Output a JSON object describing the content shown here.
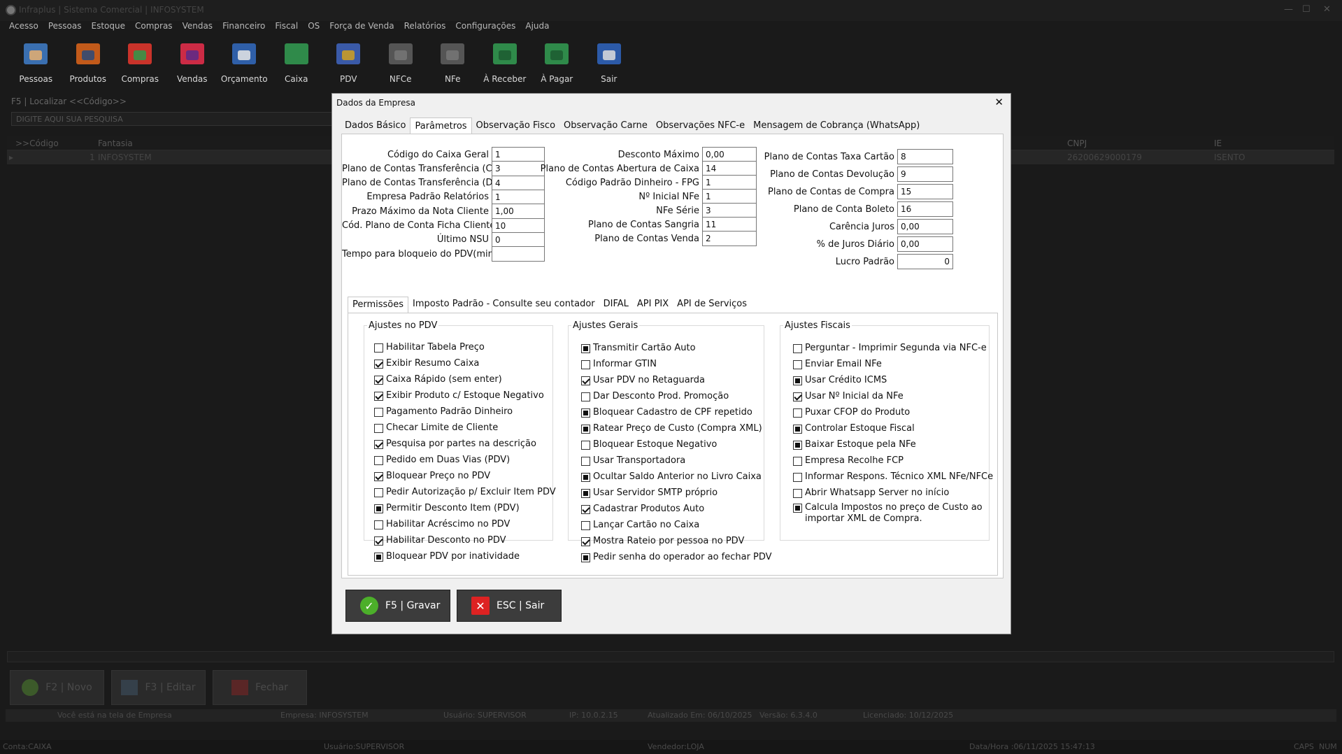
{
  "window": {
    "title": "Infraplus | Sistema Comercial | INFOSYSTEM"
  },
  "menu": [
    "Acesso",
    "Pessoas",
    "Estoque",
    "Compras",
    "Vendas",
    "Financeiro",
    "Fiscal",
    "OS",
    "Força de Venda",
    "Relatórios",
    "Configurações",
    "Ajuda"
  ],
  "toolbar": [
    "Pessoas",
    "Produtos",
    "Compras",
    "Vendas",
    "Orçamento",
    "Caixa",
    "PDV",
    "NFCe",
    "NFe",
    "À Receber",
    "À Pagar",
    "Sair"
  ],
  "background": {
    "search_label": "F5 | Localizar <<Código>>",
    "search_placeholder": "DIGITE AQUI SUA PESQUISA",
    "col_code": ">>Código",
    "col_fantasia": "Fantasia",
    "col_cnpj": "CNPJ",
    "col_ie": "IE",
    "row_code": "1",
    "row_fantasia": "INFOSYSTEM",
    "row_cnpj": "26200629000179",
    "row_ie": "ISENTO",
    "btn_new": "F2 | Novo",
    "btn_edit": "F3 | Editar",
    "btn_close": "Fechar",
    "status_screen": "Você está na tela de Empresa",
    "status_company": "Empresa: INFOSYSTEM",
    "status_user": "Usuário: SUPERVISOR",
    "status_ip": "IP: 10.0.2.15",
    "status_updated": "Atualizado Em: 06/10/2025",
    "status_version": "Versão: 6.3.4.0",
    "status_license": "Licenciado: 10/12/2025",
    "bottom_conta": "Conta:CAIXA",
    "bottom_user": "Usuário:SUPERVISOR",
    "bottom_seller": "Vendedor:LOJA",
    "bottom_datetime": "Data/Hora :06/11/2025 15:47:13",
    "bottom_caps": "CAPS",
    "bottom_num": "NUM"
  },
  "dialog": {
    "title": "Dados da Empresa",
    "tabs": [
      "Dados Básico",
      "Parâmetros",
      "Observação Fisco",
      "Observação Carne",
      "Observações NFC-e",
      "Mensagem de Cobrança (WhatsApp)"
    ],
    "params_col1": [
      {
        "label": "Código do Caixa Geral",
        "value": "1"
      },
      {
        "label": "Plano de Contas Transferência (Crédito)",
        "value": "3"
      },
      {
        "label": "Plano de Contas Transferência (Débito)",
        "value": "4"
      },
      {
        "label": "Empresa Padrão Relatórios",
        "value": "1"
      },
      {
        "label": "Prazo Máximo da Nota Cliente",
        "value": "1,00"
      },
      {
        "label": "Cód. Plano de Conta Ficha Cliente",
        "value": "10"
      },
      {
        "label": "Último NSU",
        "value": "0"
      },
      {
        "label": "Tempo para bloqueio do PDV(minutos)",
        "value": ""
      }
    ],
    "params_col2": [
      {
        "label": "Desconto Máximo",
        "value": "0,00"
      },
      {
        "label": "Plano de Contas Abertura de Caixa",
        "value": "14"
      },
      {
        "label": "Código Padrão Dinheiro - FPG",
        "value": "1"
      },
      {
        "label": "Nº Inicial NFe",
        "value": "1"
      },
      {
        "label": "NFe Série",
        "value": "3"
      },
      {
        "label": "Plano de Contas Sangria",
        "value": "11"
      },
      {
        "label": "Plano de Contas Venda",
        "value": "2"
      }
    ],
    "params_col3": [
      {
        "label": "Plano de Contas Taxa Cartão",
        "value": "8"
      },
      {
        "label": "Plano de Contas Devolução",
        "value": "9"
      },
      {
        "label": "Plano de Contas de Compra",
        "value": "15"
      },
      {
        "label": "Plano de Conta Boleto",
        "value": "16"
      },
      {
        "label": "Carência Juros",
        "value": "0,00"
      },
      {
        "label": "% de Juros Diário",
        "value": "0,00"
      },
      {
        "label": "Lucro Padrão",
        "value": "0"
      }
    ],
    "subtabs": [
      "Permissões",
      "Imposto Padrão - Consulte seu contador",
      "DIFAL",
      "API PIX",
      "API de Serviços"
    ],
    "groups": {
      "pdv": {
        "title": "Ajustes no PDV",
        "items": [
          {
            "label": "Habilitar Tabela Preço",
            "state": "unchecked"
          },
          {
            "label": "Exibir Resumo Caixa",
            "state": "checked"
          },
          {
            "label": "Caixa Rápido (sem enter)",
            "state": "checked"
          },
          {
            "label": "Exibir Produto c/ Estoque Negativo",
            "state": "checked"
          },
          {
            "label": "Pagamento Padrão Dinheiro",
            "state": "unchecked"
          },
          {
            "label": "Checar Limite de Cliente",
            "state": "unchecked"
          },
          {
            "label": "Pesquisa por partes na descrição",
            "state": "checked"
          },
          {
            "label": "Pedido em Duas Vias (PDV)",
            "state": "unchecked"
          },
          {
            "label": "Bloquear Preço no PDV",
            "state": "checked"
          },
          {
            "label": "Pedir Autorização  p/ Excluir Item PDV",
            "state": "unchecked"
          },
          {
            "label": "Permitir Desconto Item (PDV)",
            "state": "filled"
          },
          {
            "label": "Habilitar Acréscimo no PDV",
            "state": "unchecked"
          },
          {
            "label": "Habilitar Desconto no PDV",
            "state": "checked"
          },
          {
            "label": "Bloquear PDV por inatividade",
            "state": "filled"
          }
        ]
      },
      "gerais": {
        "title": "Ajustes Gerais",
        "items": [
          {
            "label": "Transmitir Cartão Auto",
            "state": "filled"
          },
          {
            "label": "Informar GTIN",
            "state": "unchecked"
          },
          {
            "label": "Usar PDV no Retaguarda",
            "state": "checked"
          },
          {
            "label": "Dar Desconto Prod. Promoção",
            "state": "unchecked"
          },
          {
            "label": "Bloquear Cadastro de CPF repetido",
            "state": "filled"
          },
          {
            "label": "Ratear Preço de Custo (Compra XML)",
            "state": "filled"
          },
          {
            "label": "Bloquear Estoque Negativo",
            "state": "unchecked"
          },
          {
            "label": "Usar Transportadora",
            "state": "unchecked"
          },
          {
            "label": "Ocultar Saldo Anterior no Livro Caixa",
            "state": "filled"
          },
          {
            "label": "Usar Servidor SMTP próprio",
            "state": "filled"
          },
          {
            "label": "Cadastrar Produtos Auto",
            "state": "checked"
          },
          {
            "label": "Lançar Cartão no Caixa",
            "state": "unchecked"
          },
          {
            "label": "Mostra Rateio por pessoa no PDV",
            "state": "checked"
          },
          {
            "label": "Pedir senha do operador ao fechar PDV",
            "state": "filled"
          }
        ]
      },
      "fiscais": {
        "title": "Ajustes Fiscais",
        "items": [
          {
            "label": "Perguntar - Imprimir Segunda via NFC-e",
            "state": "unchecked"
          },
          {
            "label": "Enviar Email  NFe",
            "state": "unchecked"
          },
          {
            "label": "Usar Crédito ICMS",
            "state": "filled"
          },
          {
            "label": "Usar Nº Inicial da NFe",
            "state": "checked"
          },
          {
            "label": "Puxar CFOP do Produto",
            "state": "unchecked"
          },
          {
            "label": "Controlar Estoque Fiscal",
            "state": "filled"
          },
          {
            "label": "Baixar Estoque pela NFe",
            "state": "filled"
          },
          {
            "label": "Empresa Recolhe FCP",
            "state": "unchecked"
          },
          {
            "label": "Informar Respons. Técnico XML NFe/NFCe",
            "state": "unchecked"
          },
          {
            "label": "Abrir Whatsapp Server no início",
            "state": "unchecked"
          }
        ],
        "last_line1": "Calcula Impostos no preço de Custo ao",
        "last_line2": "importar XML de Compra.",
        "last_state": "filled"
      }
    },
    "btn_save": "F5 | Gravar",
    "btn_exit": "ESC | Sair"
  }
}
